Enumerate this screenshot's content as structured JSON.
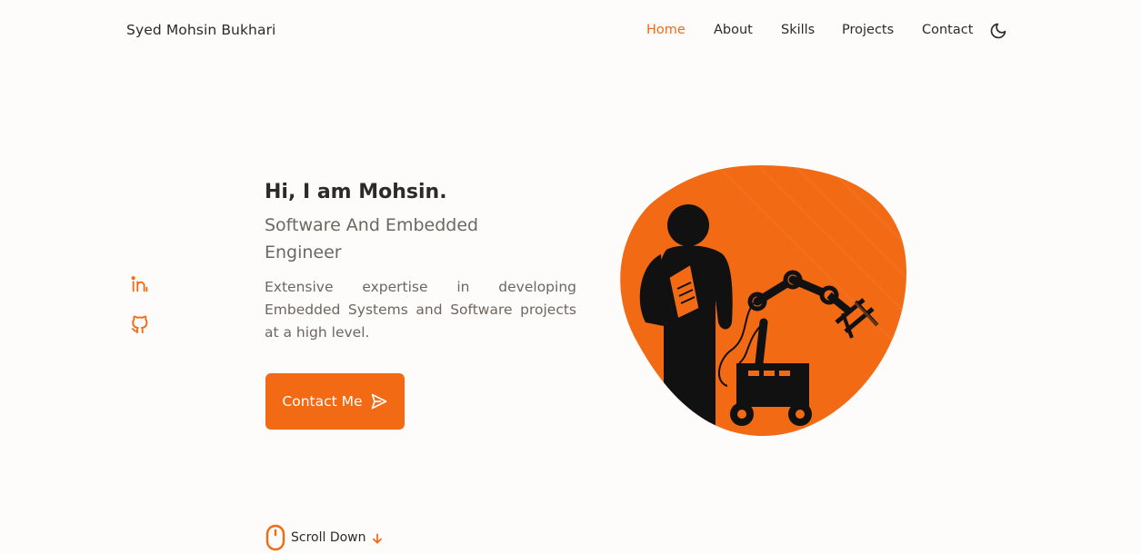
{
  "header": {
    "logo": "Syed Mohsin Bukhari",
    "nav": [
      {
        "label": "Home",
        "active": true
      },
      {
        "label": "About",
        "active": false
      },
      {
        "label": "Skills",
        "active": false
      },
      {
        "label": "Projects",
        "active": false
      },
      {
        "label": "Contact",
        "active": false
      }
    ],
    "theme_toggle_icon": "moon-icon"
  },
  "socials": [
    {
      "icon": "linkedin-icon"
    },
    {
      "icon": "github-icon"
    }
  ],
  "hero": {
    "title": "Hi, I am Mohsin.",
    "subtitle": "Software And Embedded Engineer",
    "description": "Extensive expertise in developing Embedded Systems and Software projects at a high level.",
    "button_label": "Contact Me",
    "button_icon": "send-icon",
    "image_icon": "engineer-robot-illustration"
  },
  "scroll": {
    "label": "Scroll Down",
    "mouse_icon": "mouse-icon",
    "arrow_icon": "arrow-down-icon"
  },
  "colors": {
    "accent": "#f26a13",
    "background": "#fefcfa",
    "text": "#2b2b2b",
    "muted": "#6e6660"
  }
}
